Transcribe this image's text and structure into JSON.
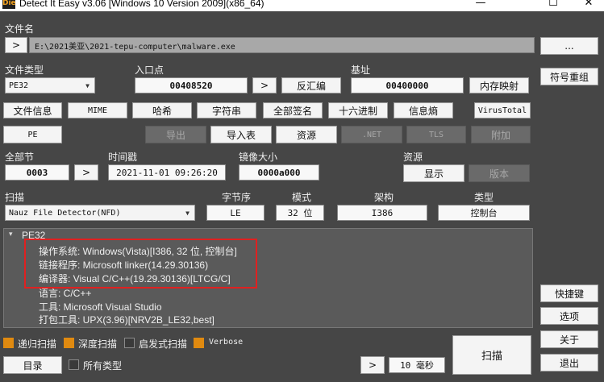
{
  "window": {
    "app_icon": "Die",
    "title": "Detect It Easy v3.06 [Windows 10 Version 2009](x86_64)",
    "min": "—",
    "max": "☐",
    "close": "✕"
  },
  "file": {
    "label": "文件名",
    "nav_btn": ">",
    "path": "E:\\2021美亚\\2021-tepu-computer\\malware.exe",
    "browse_btn": "..."
  },
  "filetype": {
    "label": "文件类型",
    "value": "PE32"
  },
  "entry": {
    "label": "入口点",
    "value": "00408520",
    "nav_btn": ">",
    "disasm_btn": "反汇编"
  },
  "base": {
    "label": "基址",
    "value": "00400000",
    "memmap_btn": "内存映射"
  },
  "symbols_btn": "符号重组",
  "row_buttons": [
    "文件信息",
    "MIME",
    "哈希",
    "字符串",
    "全部签名",
    "十六进制",
    "信息熵",
    "VirusTotal"
  ],
  "row2": {
    "pe": "PE",
    "export": "导出",
    "import": "导入表",
    "resource": "资源",
    "net": ".NET",
    "tls": "TLS",
    "overlay": "附加"
  },
  "sections": {
    "label": "全部节",
    "value": "0003",
    "nav_btn": ">"
  },
  "timestamp": {
    "label": "时间戳",
    "value": "2021-11-01 09:26:20"
  },
  "image_size": {
    "label": "镜像大小",
    "value": "0000a000"
  },
  "resources": {
    "label": "资源",
    "show_btn": "显示",
    "version_btn": "版本"
  },
  "scan": {
    "label": "扫描",
    "engine": "Nauz File Detector(NFD)",
    "endian_label": "字节序",
    "endian": "LE",
    "mode_label": "模式",
    "mode": "32 位",
    "arch_label": "架构",
    "arch": "I386",
    "type_label": "类型",
    "type": "控制台"
  },
  "result": {
    "toggle": "▾",
    "root": "PE32",
    "lines": [
      "操作系统: Windows(Vista)[I386, 32 位, 控制台]",
      "链接程序: Microsoft linker(14.29.30136)",
      "编译器: Visual C/C++(19.29.30136)[LTCG/C]",
      "语言: C/C++",
      "工具: Microsoft Visual Studio",
      "打包工具: UPX(3.96)[NRV2B_LE32,best]"
    ]
  },
  "side_buttons": {
    "shortcuts": "快捷键",
    "options": "选项",
    "about": "关于",
    "exit": "退出"
  },
  "options": {
    "recursive": "递归扫描",
    "deep": "深度扫描",
    "heuristic": "启发式扫描",
    "verbose": "Verbose",
    "all_types": "所有类型"
  },
  "bottom": {
    "dir_btn": "目录",
    "nav_btn": ">",
    "time": "10 毫秒",
    "scan_btn": "扫描"
  },
  "colors": {
    "accent": "#e08a10",
    "highlight": "#e02020",
    "background": "#464646"
  }
}
